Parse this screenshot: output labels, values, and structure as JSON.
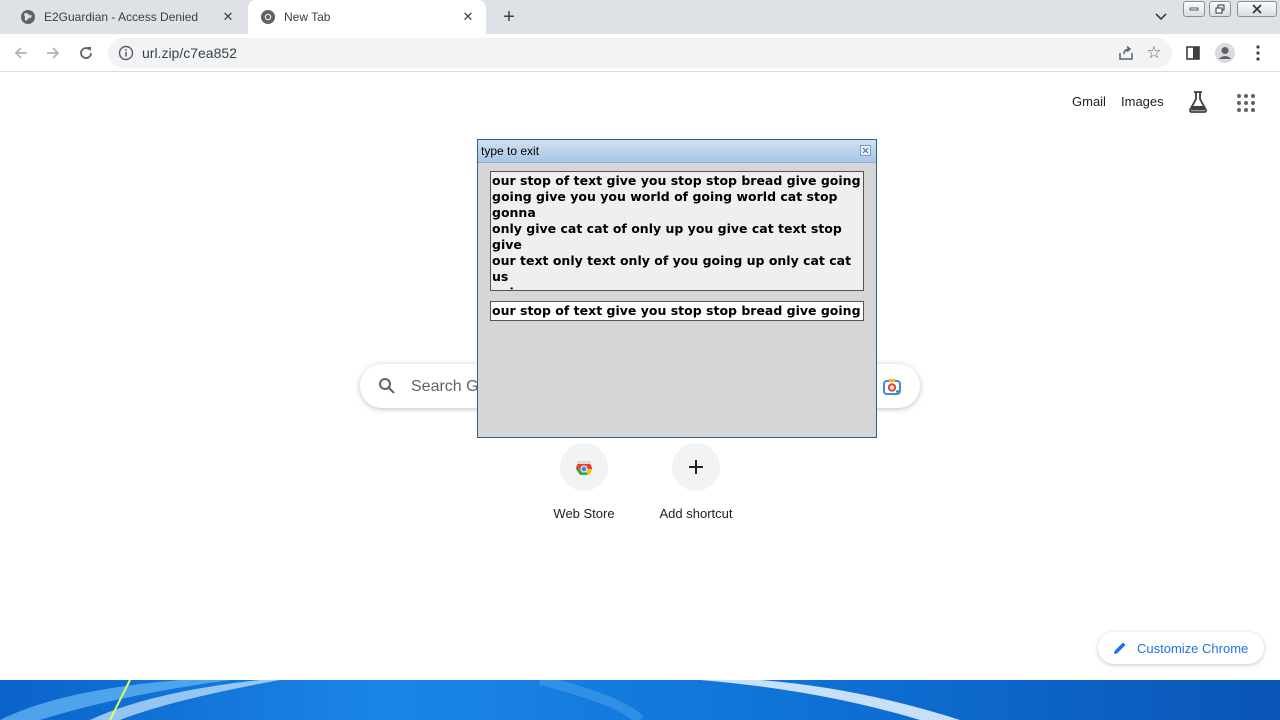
{
  "tabs": [
    {
      "title": "E2Guardian - Access Denied",
      "active": false,
      "favicon": "globe-icon"
    },
    {
      "title": "New Tab",
      "active": true,
      "favicon": "chrome-icon"
    }
  ],
  "address_bar": {
    "url": "url.zip/c7ea852"
  },
  "top_links": {
    "gmail": "Gmail",
    "images": "Images"
  },
  "search": {
    "placeholder": "Search Go"
  },
  "shortcuts": [
    {
      "label": "Web Store",
      "icon": "web-store-icon"
    },
    {
      "label": "Add shortcut",
      "icon": "plus-icon"
    }
  ],
  "customize": {
    "label": "Customize Chrome"
  },
  "dialog": {
    "title": "type to exit",
    "prompt_text": "our stop of text give you stop stop bread give going\ngoing give you you world of going world cat stop gonna\nonly give cat cat of only up you give cat text stop give\nour text only text only of you going up only cat cat us\ngoing us",
    "input_value": "our stop of text give you stop stop bread give going goi"
  },
  "colors": {
    "accent": "#1a73e8",
    "tabstrip": "#dee1e6",
    "dialog_bg": "#d6d6d6"
  }
}
